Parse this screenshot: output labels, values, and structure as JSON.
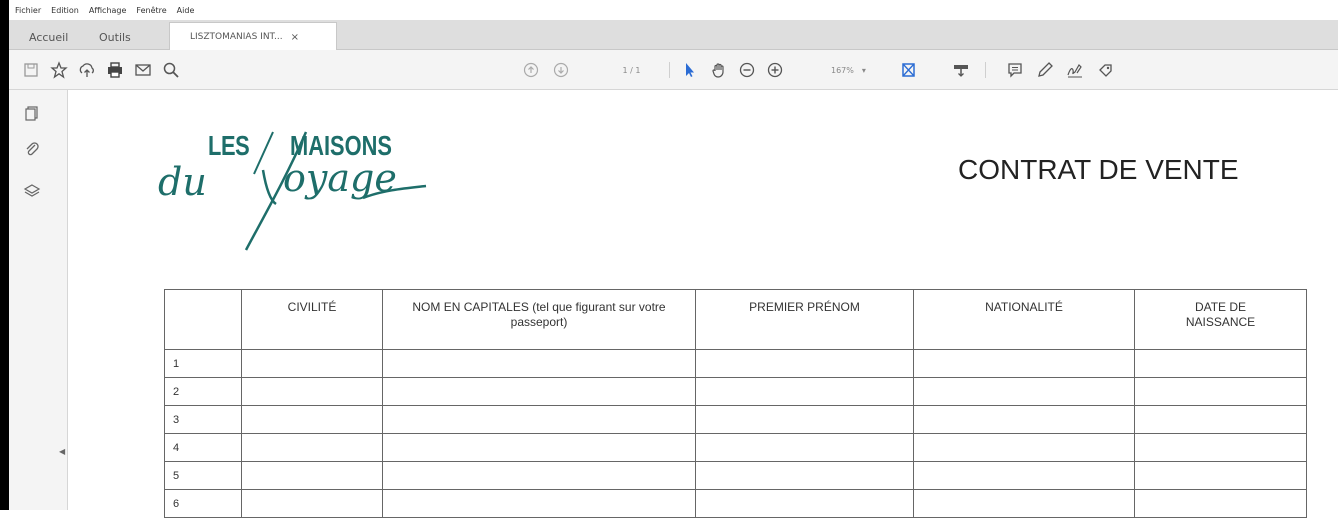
{
  "menu": [
    "Fichier",
    "Edition",
    "Affichage",
    "Fenêtre",
    "Aide"
  ],
  "tabs": {
    "home": "Accueil",
    "tools": "Outils",
    "document": "LISZTOMANIAS INT...",
    "close": "×"
  },
  "toolbar": {
    "page_indicator": "1 / 1",
    "zoom": "167%"
  },
  "document": {
    "logo_les": "LES",
    "logo_maisons": "MAISONS",
    "logo_du": "du",
    "logo_voyage": "oyage",
    "title": "CONTRAT DE VENTE",
    "table": {
      "headers": [
        "",
        "CIVILITÉ",
        "NOM EN CAPITALES (tel que figurant sur votre passeport)",
        "PREMIER PRÉNOM",
        "NATIONALITÉ",
        "DATE DE NAISSANCE"
      ],
      "rows": [
        "1",
        "2",
        "3",
        "4",
        "5",
        "6"
      ]
    }
  },
  "colors": {
    "brand": "#1e6e6a",
    "toolbar_blue": "#2b6cd4"
  }
}
